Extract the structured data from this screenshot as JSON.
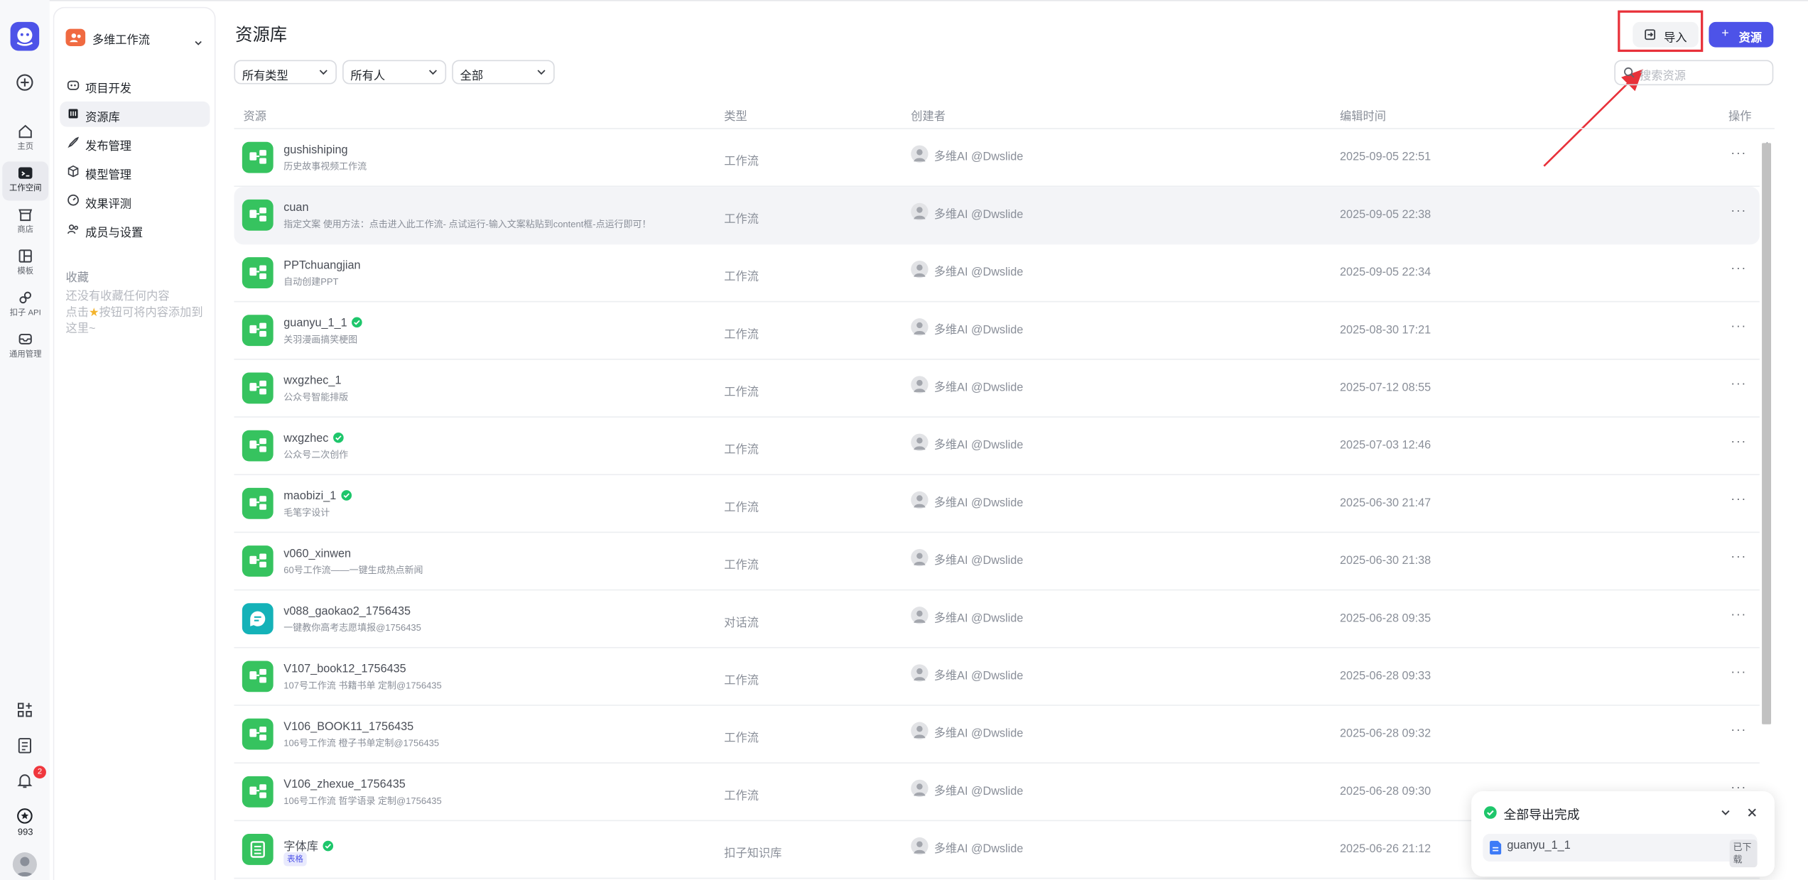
{
  "app": {
    "workspace_name": "多维工作流",
    "notification_count": "2",
    "points": "993"
  },
  "rail": {
    "items": [
      {
        "label": "主页",
        "icon": "home-icon"
      },
      {
        "label": "工作空间",
        "icon": "workspace-icon"
      },
      {
        "label": "商店",
        "icon": "store-icon"
      },
      {
        "label": "模板",
        "icon": "template-icon"
      },
      {
        "label": "扣子 API",
        "icon": "api-icon"
      },
      {
        "label": "通用管理",
        "icon": "inbox-icon"
      }
    ]
  },
  "sidebar": {
    "nav": [
      {
        "label": "项目开发",
        "icon": "robot-icon"
      },
      {
        "label": "资源库",
        "icon": "library-icon"
      },
      {
        "label": "发布管理",
        "icon": "rocket-icon"
      },
      {
        "label": "模型管理",
        "icon": "cube-icon"
      },
      {
        "label": "效果评测",
        "icon": "gauge-icon"
      },
      {
        "label": "成员与设置",
        "icon": "members-icon"
      }
    ],
    "favorites_title": "收藏",
    "favorites_empty_1": "还没有收藏任何内容",
    "favorites_empty_2a": "点击",
    "favorites_empty_2b": "按钮可将内容添加到",
    "favorites_empty_3": "这里~"
  },
  "main": {
    "title": "资源库",
    "import_label": "导入",
    "new_resource_label": "资源",
    "filters": [
      "所有类型",
      "所有人",
      "全部"
    ],
    "search_placeholder": "搜索资源",
    "columns": [
      "资源",
      "类型",
      "创建者",
      "编辑时间",
      "操作"
    ]
  },
  "resources": [
    {
      "name": "gushishiping",
      "desc": "历史故事视频工作流",
      "type": "工作流",
      "creator": "多维AI @Dwslide",
      "time": "2025-09-05 22:51",
      "kind": "workflow",
      "verified": false
    },
    {
      "name": "cuan",
      "desc": "指定文案 使用方法：点击进入此工作流- 点试运行-输入文案粘贴到content框-点运行即可！",
      "type": "工作流",
      "creator": "多维AI @Dwslide",
      "time": "2025-09-05 22:38",
      "kind": "workflow",
      "verified": false
    },
    {
      "name": "PPTchuangjian",
      "desc": "自动创建PPT",
      "type": "工作流",
      "creator": "多维AI @Dwslide",
      "time": "2025-09-05 22:34",
      "kind": "workflow",
      "verified": false
    },
    {
      "name": "guanyu_1_1",
      "desc": "关羽漫画搞笑梗图",
      "type": "工作流",
      "creator": "多维AI @Dwslide",
      "time": "2025-08-30 17:21",
      "kind": "workflow",
      "verified": true
    },
    {
      "name": "wxgzhec_1",
      "desc": "公众号智能排版",
      "type": "工作流",
      "creator": "多维AI @Dwslide",
      "time": "2025-07-12 08:55",
      "kind": "workflow",
      "verified": false
    },
    {
      "name": "wxgzhec",
      "desc": "公众号二次创作",
      "type": "工作流",
      "creator": "多维AI @Dwslide",
      "time": "2025-07-03 12:46",
      "kind": "workflow",
      "verified": true
    },
    {
      "name": "maobizi_1",
      "desc": "毛笔字设计",
      "type": "工作流",
      "creator": "多维AI @Dwslide",
      "time": "2025-06-30 21:47",
      "kind": "workflow",
      "verified": true
    },
    {
      "name": "v060_xinwen",
      "desc": "60号工作流——一键生成热点新闻",
      "type": "工作流",
      "creator": "多维AI @Dwslide",
      "time": "2025-06-30 21:38",
      "kind": "workflow",
      "verified": false
    },
    {
      "name": "v088_gaokao2_1756435",
      "desc": "一键教你高考志愿填报@1756435",
      "type": "对话流",
      "creator": "多维AI @Dwslide",
      "time": "2025-06-28 09:35",
      "kind": "chatflow",
      "verified": false
    },
    {
      "name": "V107_book12_1756435",
      "desc": "107号工作流 书籍书单 定制@1756435",
      "type": "工作流",
      "creator": "多维AI @Dwslide",
      "time": "2025-06-28 09:33",
      "kind": "workflow",
      "verified": false
    },
    {
      "name": "V106_BOOK11_1756435",
      "desc": "106号工作流 橙子书单定制@1756435",
      "type": "工作流",
      "creator": "多维AI @Dwslide",
      "time": "2025-06-28 09:32",
      "kind": "workflow",
      "verified": false
    },
    {
      "name": "V106_zhexue_1756435",
      "desc": "106号工作流 哲学语录 定制@1756435",
      "type": "工作流",
      "creator": "多维AI @Dwslide",
      "time": "2025-06-28 09:30",
      "kind": "workflow",
      "verified": false
    },
    {
      "name": "字体库",
      "desc": "",
      "tag": "表格",
      "type": "扣子知识库",
      "creator": "多维AI @Dwslide",
      "time": "2025-06-26 21:12",
      "kind": "knowledge",
      "verified": true
    }
  ],
  "toast": {
    "title": "全部导出完成",
    "file_name": "guanyu_1_1",
    "status": "已下载"
  },
  "colors": {
    "accent": "#4d53e8",
    "workflow": "#36c35f",
    "chatflow": "#14b2b8",
    "verified": "#1ec66b",
    "annotation": "#e8313a"
  }
}
